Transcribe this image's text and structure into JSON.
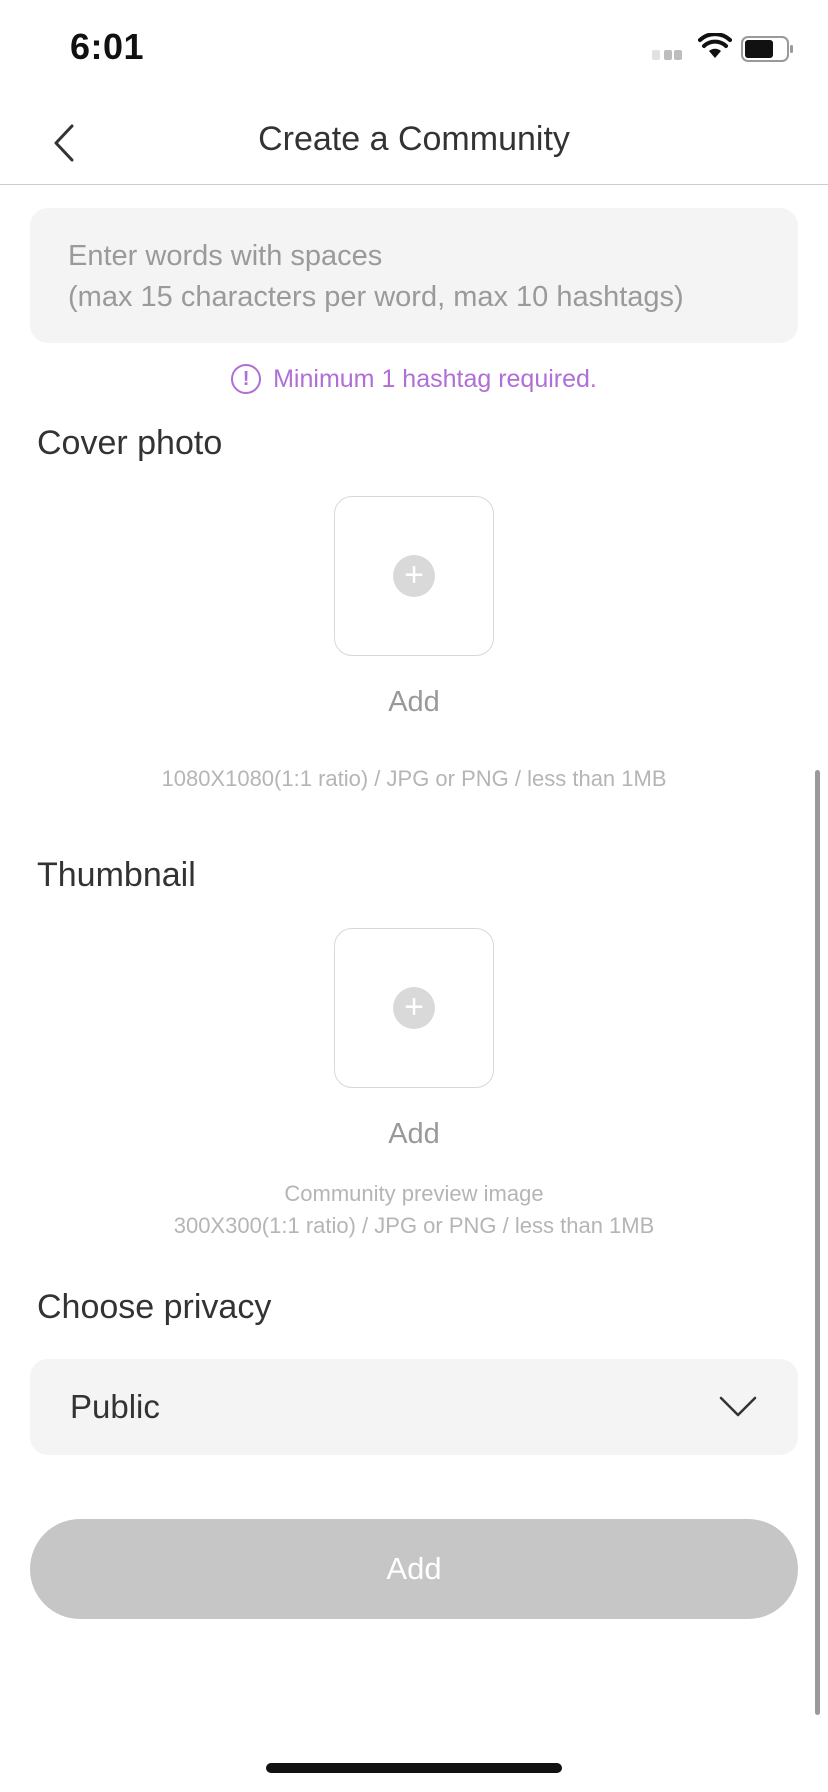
{
  "status_bar": {
    "time": "6:01"
  },
  "header": {
    "title": "Create a Community"
  },
  "hashtags": {
    "placeholder_line1": "Enter words with spaces",
    "placeholder_line2": "(max 15 characters per word, max 10 hashtags)",
    "warning": "Minimum 1 hashtag required.",
    "warning_icon_glyph": "!"
  },
  "cover_photo": {
    "title": "Cover photo",
    "add_label": "Add",
    "hint": "1080X1080(1:1 ratio) / JPG or PNG / less than 1MB"
  },
  "thumbnail": {
    "title": "Thumbnail",
    "add_label": "Add",
    "hint_line1": "Community preview image",
    "hint_line2": "300X300(1:1 ratio) / JPG or PNG / less than 1MB"
  },
  "privacy": {
    "title": "Choose privacy",
    "selected": "Public"
  },
  "submit": {
    "label": "Add"
  },
  "icons": {
    "back": "chevron-left-icon",
    "plus": "plus-icon",
    "dropdown": "chevron-down-icon",
    "warning": "alert-circle-icon"
  },
  "colors": {
    "accent_warning": "#b06ed6",
    "disabled_button": "#c6c6c6",
    "field_background": "#f4f4f4"
  }
}
